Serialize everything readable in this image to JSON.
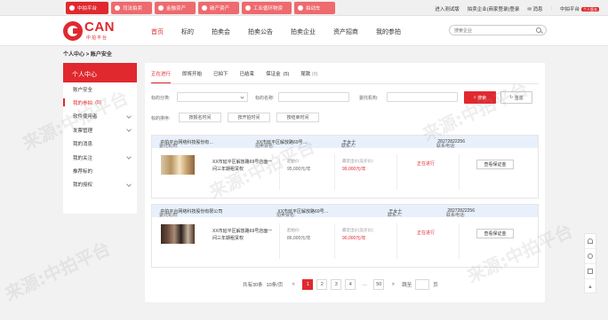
{
  "topbar": {
    "tabs": [
      {
        "label": "中拍平台",
        "active": true
      },
      {
        "label": "司法拍卖",
        "active": false
      },
      {
        "label": "金融资产",
        "active": false
      },
      {
        "label": "破产资产",
        "active": false
      },
      {
        "label": "工业循环物资",
        "active": false
      },
      {
        "label": "拍动车",
        "active": false
      }
    ],
    "links": {
      "test_version": "进入测试版",
      "login": "拍卖企业(商家登录)登录",
      "messages": "消息",
      "platform": "中拍平台",
      "platform_badge": "个人版本"
    }
  },
  "header": {
    "logo_text": "CAN",
    "logo_sub": "中拍平台",
    "nav": [
      "首页",
      "标的",
      "拍卖会",
      "拍卖公告",
      "拍卖企业",
      "资产招商",
      "我的参拍"
    ],
    "active_nav": "首页",
    "search_placeholder": "搜索企业"
  },
  "breadcrumb": {
    "root": "个人中心",
    "sep": ">",
    "current": "账户安全"
  },
  "sidebar": {
    "title": "个人中心",
    "items": [
      {
        "label": "账户安全",
        "active": false
      },
      {
        "label": "我的参拍",
        "count": "(5)",
        "active": true
      },
      {
        "label": "软件使用者",
        "active": false
      },
      {
        "label": "发票管理",
        "active": false
      },
      {
        "label": "我的消息",
        "active": false
      },
      {
        "label": "我的关注",
        "active": false
      },
      {
        "label": "推荐标的",
        "active": false
      },
      {
        "label": "我的授权",
        "active": false
      }
    ]
  },
  "tabs": [
    {
      "label": "正在进行",
      "active": true
    },
    {
      "label": "即将开始",
      "active": false
    },
    {
      "label": "已拍下",
      "active": false
    },
    {
      "label": "已结束",
      "active": false
    },
    {
      "label": "保证金",
      "count": "(5)",
      "active": false
    },
    {
      "label": "尾款",
      "count": "(0)",
      "active": false
    }
  ],
  "filters": {
    "category_label": "标的分类:",
    "name_label": "标的名称:",
    "org_label": "委托机构:",
    "sort_label": "标的排序:",
    "search_button": "搜索",
    "reset_button": "重置",
    "sort_buttons": [
      "按报名时间",
      "按开拍时间",
      "按结束时间"
    ]
  },
  "listings": [
    {
      "org_label": "委托机构:",
      "org": "中拍平台网络科技股份有…",
      "auction_label": "拍卖会名:",
      "auction": "XX市延平区解放路69号…",
      "contact_label": "联系人:",
      "contact": "王女士",
      "phone_label": "联系电话:",
      "phone": "28272822256",
      "title": "XX市延平区解放路69号店面一间三年期租赁权",
      "start_price_label": "起拍价:",
      "start_price": "95,000元/年",
      "current_price_label": "最近出价(竞买价):",
      "current_price": "99,000元/年",
      "status": "正在进行",
      "action": "查看保证金"
    },
    {
      "org_label": "委托机构:",
      "org": "中拍平台网络科技股份有限公司",
      "auction_label": "拍卖会名:",
      "auction": "XX市延平区解放路69号…",
      "contact_label": "联系人:",
      "contact": "王女士",
      "phone_label": "联系电话:",
      "phone": "28272822256",
      "title": "XX市延平区解放路69号店面一间三年期租赁权",
      "start_price_label": "起拍价:",
      "start_price": "86,000元/年",
      "current_price_label": "最近出价(竞买价):",
      "current_price": "90,000元/年",
      "status": "正在进行",
      "action": "查看保证金"
    }
  ],
  "pagination": {
    "total": "共有30条",
    "per_page": "10条/页",
    "prev": "<",
    "pages": [
      "1",
      "2",
      "3",
      "4",
      "…",
      "50"
    ],
    "current": "1",
    "next": ">",
    "jump_label": "跳至",
    "page_unit": "页"
  },
  "watermark": "来源:中拍平台",
  "colors": {
    "brand": "#e0292f",
    "header_row": "#e8f0fb"
  },
  "float_icons": [
    "headset-icon",
    "refresh-icon",
    "document-icon",
    "up-arrow-icon"
  ]
}
